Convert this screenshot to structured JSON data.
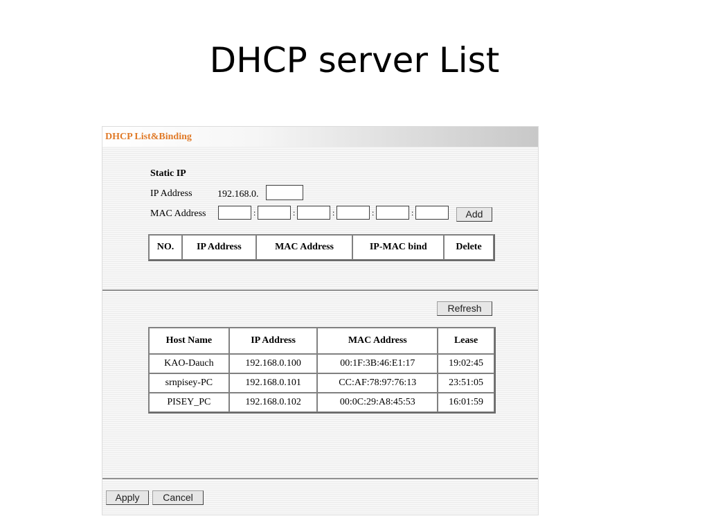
{
  "slide": {
    "title": "DHCP server List"
  },
  "panel": {
    "header": "DHCP List&Binding"
  },
  "static_ip": {
    "heading": "Static IP",
    "ip_label": "IP Address",
    "ip_prefix": "192.168.0.",
    "ip_value": "",
    "mac_label": "MAC Address",
    "mac_values": [
      "",
      "",
      "",
      "",
      "",
      ""
    ],
    "separator": ":",
    "add_label": "Add"
  },
  "binding_table": {
    "headers": [
      "NO.",
      "IP Address",
      "MAC Address",
      "IP-MAC bind",
      "Delete"
    ],
    "rows": []
  },
  "refresh_label": "Refresh",
  "clients_table": {
    "headers": [
      "Host Name",
      "IP Address",
      "MAC Address",
      "Lease"
    ],
    "rows": [
      [
        "KAO-Dauch",
        "192.168.0.100",
        "00:1F:3B:46:E1:17",
        "19:02:45"
      ],
      [
        "srnpisey-PC",
        "192.168.0.101",
        "CC:AF:78:97:76:13",
        "23:51:05"
      ],
      [
        "PISEY_PC",
        "192.168.0.102",
        "00:0C:29:A8:45:53",
        "16:01:59"
      ]
    ]
  },
  "footer": {
    "apply_label": "Apply",
    "cancel_label": "Cancel"
  },
  "colors": {
    "header_text": "#e07a28",
    "panel_bg": "#f2f2f2"
  }
}
